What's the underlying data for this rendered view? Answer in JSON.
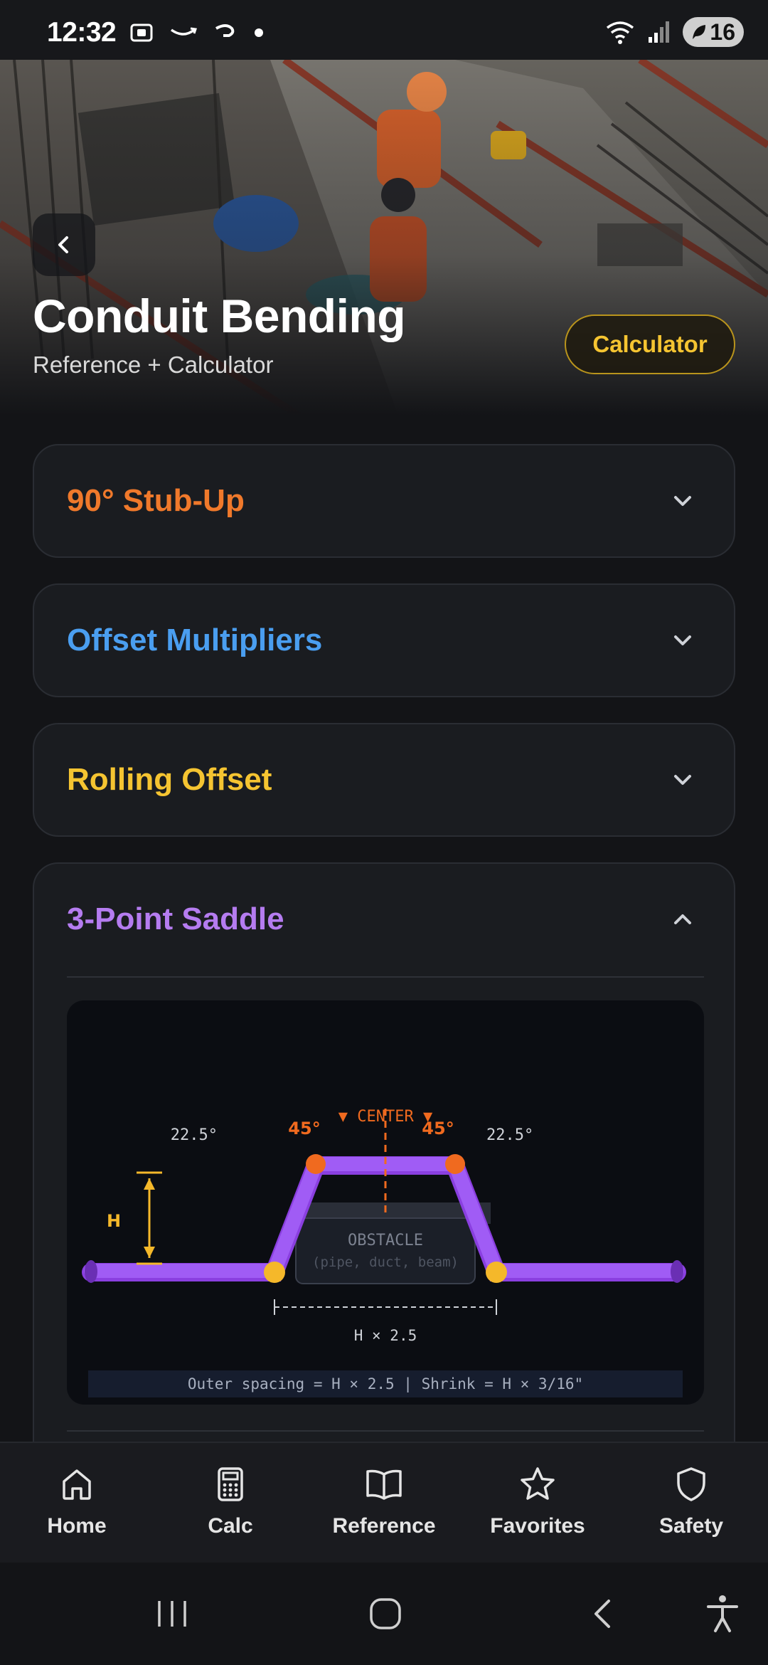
{
  "status": {
    "time": "12:32",
    "battery": "16"
  },
  "hero": {
    "title": "Conduit Bending",
    "subtitle": "Reference + Calculator",
    "calculator_label": "Calculator"
  },
  "sections": [
    {
      "title": "90° Stub-Up",
      "color": "#f0792b",
      "expanded": false
    },
    {
      "title": "Offset Multipliers",
      "color": "#4a9ef0",
      "expanded": false
    },
    {
      "title": "Rolling Offset",
      "color": "#f5c431",
      "expanded": false
    },
    {
      "title": "3-Point Saddle",
      "color": "#b57cf0",
      "expanded": true
    }
  ],
  "diagram": {
    "center_label": "▼ CENTER ▼",
    "angle_left_outer": "22.5°",
    "angle_left_inner": "45°",
    "angle_right_inner": "45°",
    "angle_right_outer": "22.5°",
    "height_label": "H",
    "obstacle_label": "OBSTACLE",
    "obstacle_sub": "(pipe, duct, beam)",
    "spacing_label": "H × 2.5",
    "formula": "Outer spacing = H × 2.5 | Shrink = H × 3/16\""
  },
  "nav": [
    {
      "label": "Home",
      "icon": "home-icon"
    },
    {
      "label": "Calc",
      "icon": "calculator-icon"
    },
    {
      "label": "Reference",
      "icon": "book-icon"
    },
    {
      "label": "Favorites",
      "icon": "star-icon"
    },
    {
      "label": "Safety",
      "icon": "shield-icon"
    }
  ]
}
